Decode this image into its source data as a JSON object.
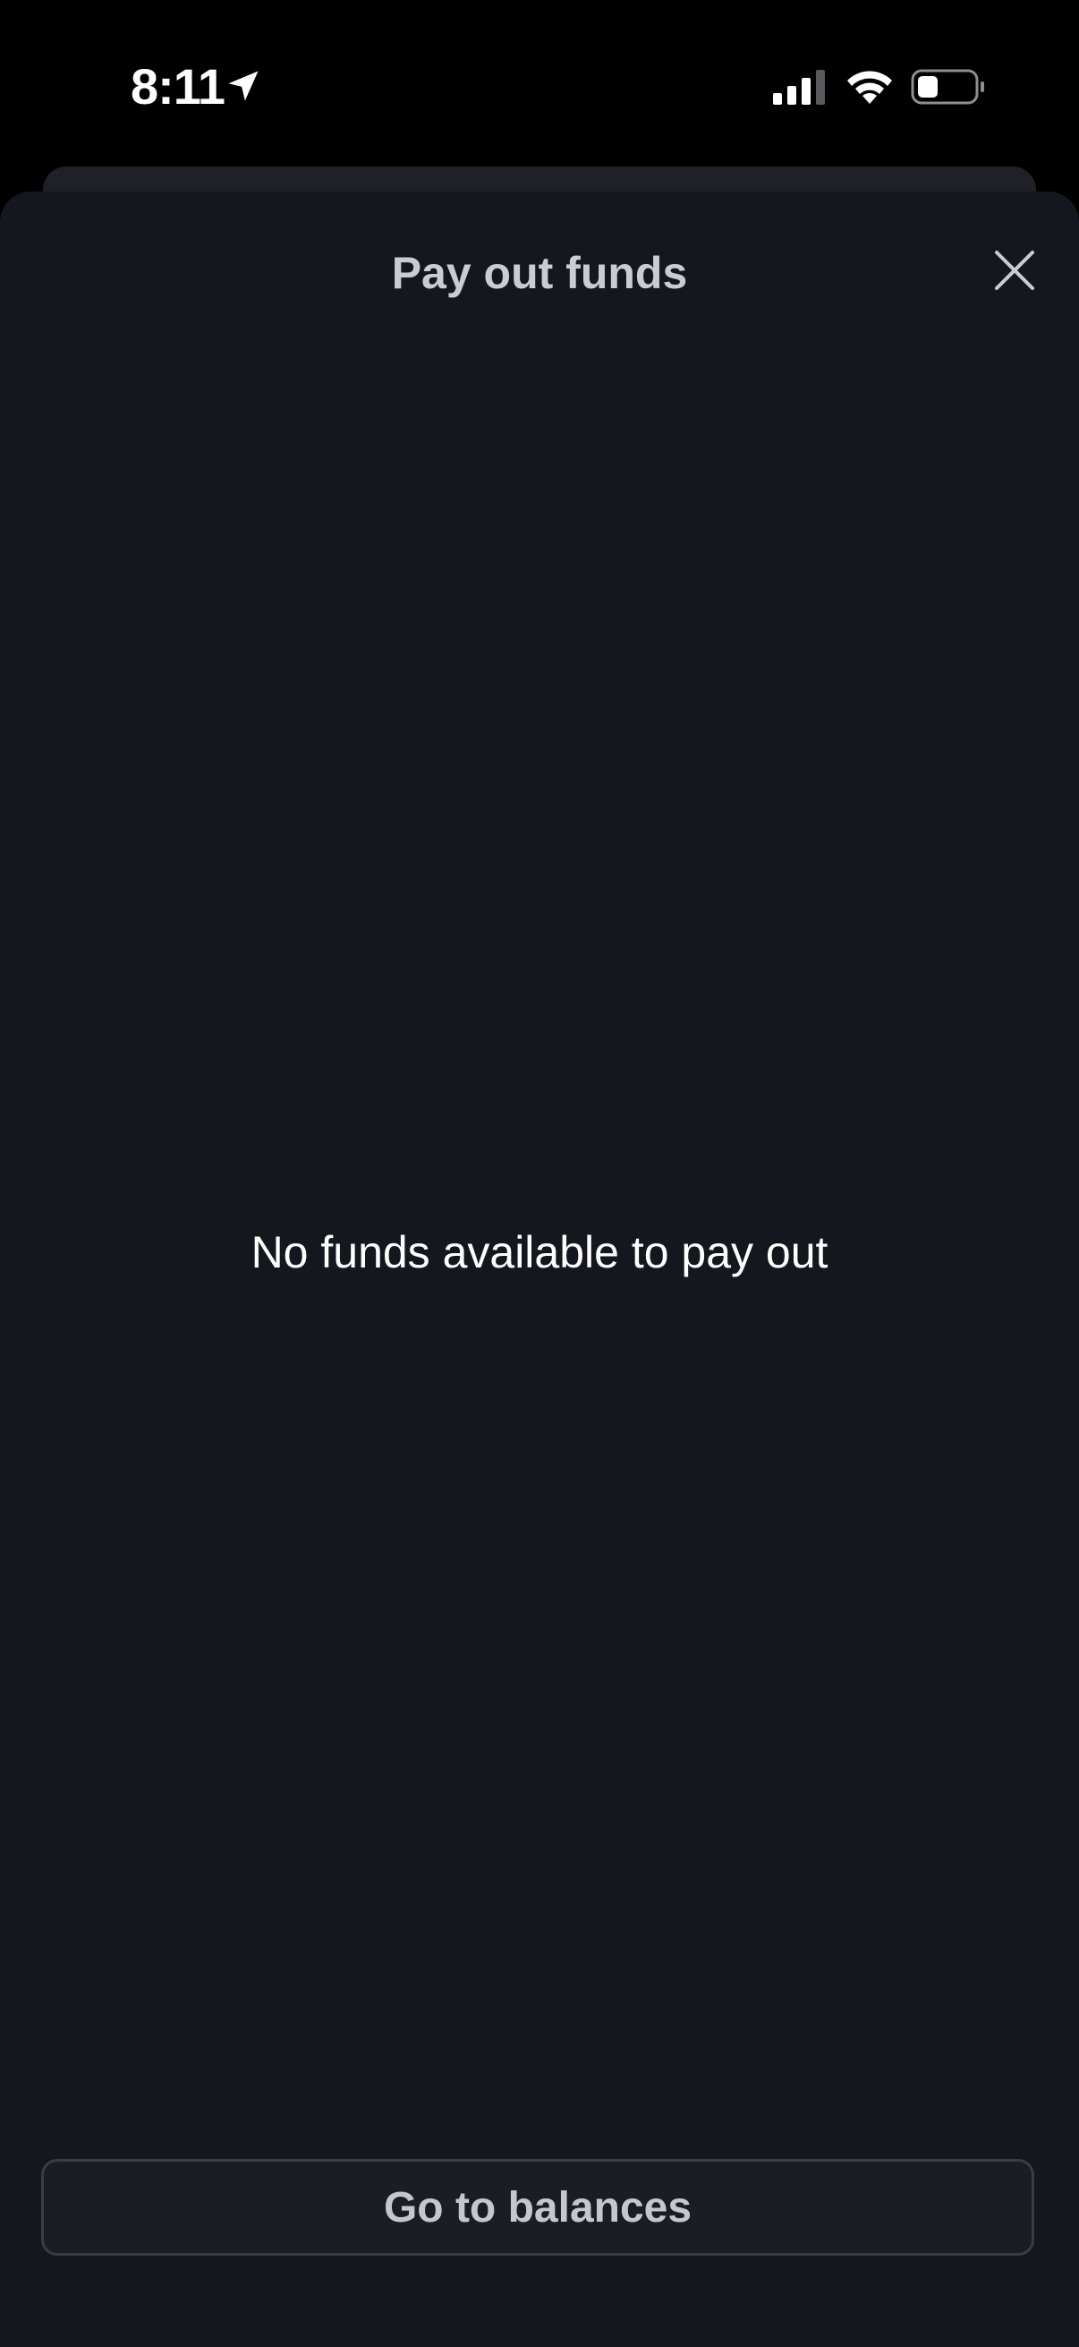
{
  "status_bar": {
    "time": "8:11",
    "icons": [
      "location-arrow-icon",
      "cellular-signal-icon",
      "wifi-icon",
      "battery-icon"
    ]
  },
  "sheet": {
    "title": "Pay out funds",
    "close_icon": "close-icon",
    "empty_message": "No funds available to pay out",
    "primary_button_label": "Go to balances"
  },
  "colors": {
    "screen_background": "#000000",
    "sheet_background": "#15171e",
    "title_text": "#c9ccd3",
    "message_text": "#ffffff",
    "button_border": "#3a3d46",
    "button_text": "#c4c7ce"
  }
}
